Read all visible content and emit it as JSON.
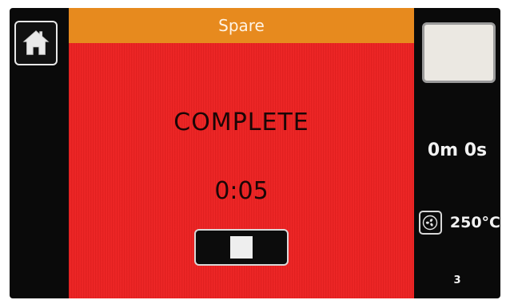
{
  "header": {
    "title": "Spare"
  },
  "nav": {
    "home_icon": "home-icon"
  },
  "main": {
    "status": "COMPLETE",
    "timer": "0:05",
    "stop_icon": "stop-icon"
  },
  "sidebar": {
    "elapsed": "0m 0s",
    "fan_icon": "fan-icon",
    "temperature": "250°C",
    "page": "3"
  },
  "colors": {
    "panel_background": "#ee2222",
    "title_bar": "#e78a1e",
    "screen_background": "#0a0a0a",
    "text_dark": "#1a0606",
    "text_light": "#f2f2f2"
  }
}
